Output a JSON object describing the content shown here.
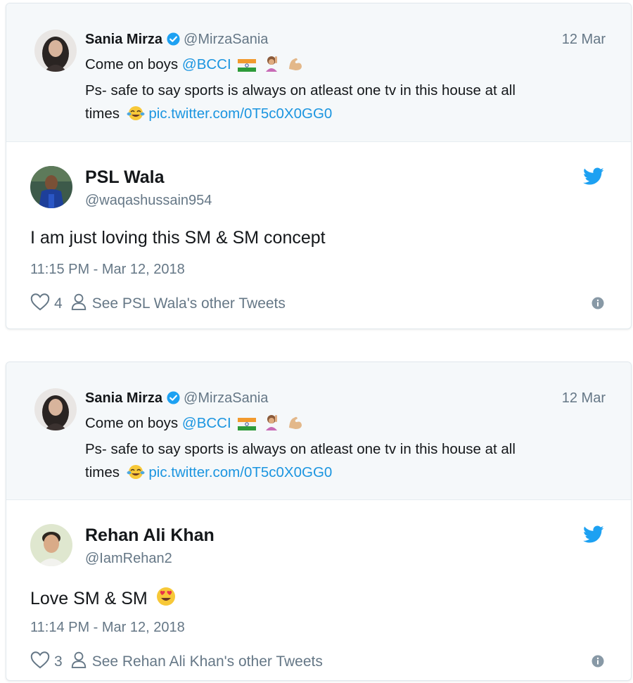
{
  "cards": [
    {
      "quoted": {
        "name": "Sania Mirza",
        "handle": "@MirzaSania",
        "date": "12 Mar",
        "line1_text": "Come on boys",
        "line1_mention": "@BCCI",
        "line2": "Ps- safe to say sports is always on atleast one tv in this house at all",
        "line3_text": "times",
        "line3_link": "pic.twitter.com/0T5c0X0GG0"
      },
      "reply": {
        "name": "PSL Wala",
        "handle": "@waqashussain954",
        "text": "I am just loving this SM & SM concept",
        "timestamp": "11:15 PM - Mar 12, 2018",
        "likes": "4",
        "other_tweets": "See PSL Wala's other Tweets"
      }
    },
    {
      "quoted": {
        "name": "Sania Mirza",
        "handle": "@MirzaSania",
        "date": "12 Mar",
        "line1_text": "Come on boys",
        "line1_mention": "@BCCI",
        "line2": "Ps- safe to say sports is always on atleast one tv in this house at all",
        "line3_text": "times",
        "line3_link": "pic.twitter.com/0T5c0X0GG0"
      },
      "reply": {
        "name": "Rehan Ali Khan",
        "handle": "@IamRehan2",
        "text": "Love SM & SM",
        "timestamp": "11:14 PM - Mar 12, 2018",
        "likes": "3",
        "other_tweets": "See Rehan Ali Khan's other Tweets"
      }
    }
  ],
  "icons": {
    "verified": "verified-badge-icon",
    "india_flag": "india-flag-icon",
    "woman_raising_hand": "woman-raising-hand-icon",
    "flexed_biceps": "flexed-biceps-icon",
    "tears_of_joy": "tears-of-joy-icon",
    "heart_eyes": "heart-eyes-icon",
    "twitter_bird": "twitter-bird-icon",
    "heart": "heart-icon",
    "person": "person-icon",
    "info": "info-icon"
  },
  "colors": {
    "link": "#1b95e0",
    "verified": "#1da1f2",
    "twitter_blue": "#1da1f2",
    "secondary_text": "#657786",
    "quoted_bg": "#f5f8fa"
  }
}
